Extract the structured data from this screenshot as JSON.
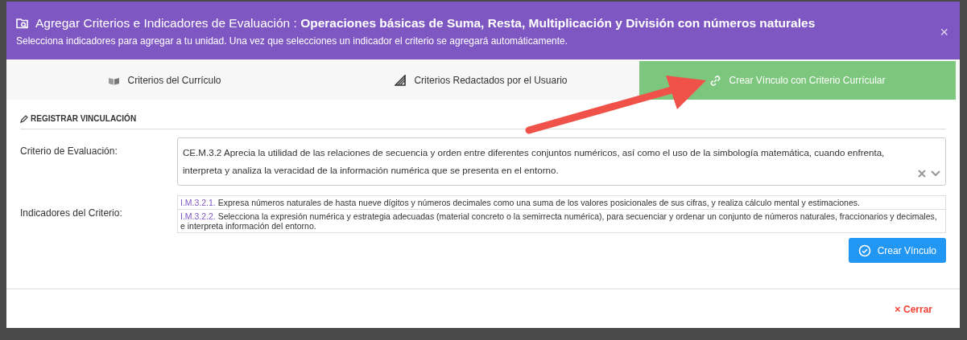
{
  "dialog": {
    "title": "Agregar Criterios e Indicadores de Evaluación :",
    "title_topic": "Operaciones básicas de Suma, Resta, Multiplicación y División con números naturales",
    "subtitle": "Selecciona indicadores para agregar a tu unidad. Una vez que selecciones un indicador el criterio se agregará automáticamente.",
    "close": "×"
  },
  "tabs": [
    {
      "label": "Criterios del Currículo",
      "selected": false
    },
    {
      "label": "Criterios Redactados por el Usuario",
      "selected": false
    },
    {
      "label": "Crear Vínculo con Criterio Currícular",
      "selected": true
    }
  ],
  "section_title": "REGISTRAR VINCULACIÓN",
  "criterio": {
    "label": "Criterio de Evaluación:",
    "value": "CE.M.3.2 Aprecia la utilidad de las relaciones de secuencia y orden entre diferentes conjuntos numéricos, así como el uso de la simbología matemática, cuando enfrenta, interpreta y analiza la veracidad de la información numérica que se presenta en el entorno."
  },
  "indicadores": {
    "label": "Indicadores del Criterio:",
    "items": [
      {
        "code": "I.M.3.2.1.",
        "text": "Expresa números naturales de hasta nueve dígitos y números decimales como una suma de los valores posicionales de sus cifras, y realiza cálculo mental y estimaciones."
      },
      {
        "code": "I.M.3.2.2.",
        "text": "Selecciona la expresión numérica y estrategia adecuadas (material concreto o la semirrecta numérica), para secuenciar y ordenar un conjunto de números naturales, fraccionarios y decimales, e interpreta información del entorno."
      }
    ]
  },
  "create_button": "Crear Vínculo",
  "footer": {
    "close_icon": "×",
    "close_label": "Cerrar"
  }
}
